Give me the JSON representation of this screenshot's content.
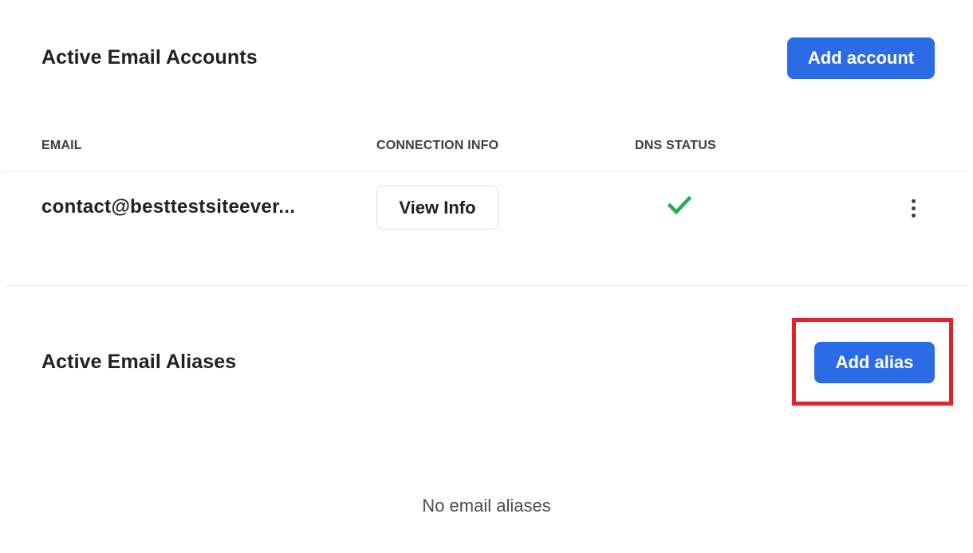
{
  "accounts_section": {
    "title": "Active Email Accounts",
    "add_button_label": "Add account",
    "columns": {
      "email": "EMAIL",
      "connection_info": "CONNECTION INFO",
      "dns_status": "DNS STATUS"
    },
    "rows": [
      {
        "email": "contact@besttestsiteever...",
        "connection_button_label": "View Info",
        "dns_status_icon": "checkmark-icon",
        "dns_status_color": "#1fad4b",
        "menu_icon": "more-vertical-icon"
      }
    ]
  },
  "aliases_section": {
    "title": "Active Email Aliases",
    "add_button_label": "Add alias",
    "empty_message": "No email aliases",
    "highlight_color": "#e4202a"
  },
  "colors": {
    "primary": "#2b6be6",
    "text": "#202124",
    "divider": "#ececec"
  }
}
